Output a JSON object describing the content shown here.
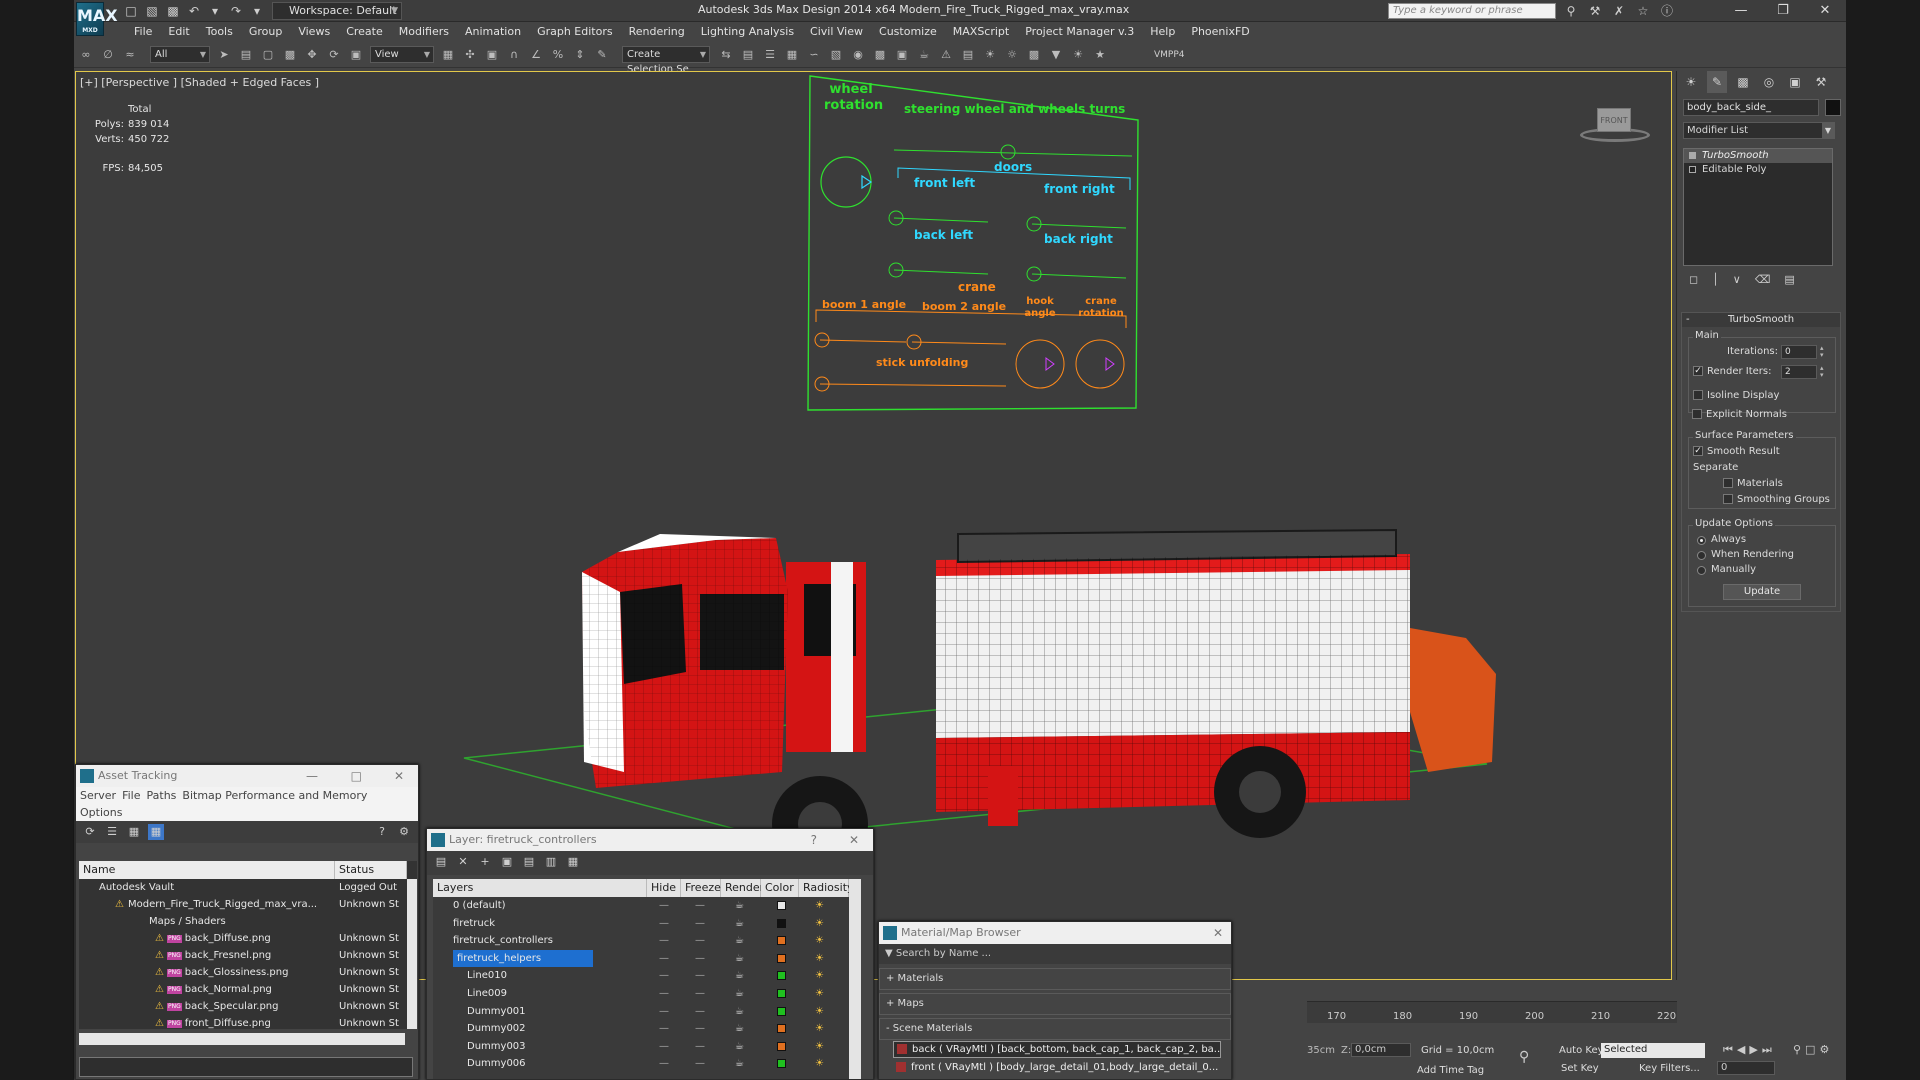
{
  "app": {
    "logo": "MAX",
    "title": "Autodesk 3ds Max Design 2014 x64     Modern_Fire_Truck_Rigged_max_vray.max",
    "workspace": "Workspace: Default",
    "search_placeholder": "Type a keyword or phrase"
  },
  "menu": [
    "File",
    "Edit",
    "Tools",
    "Group",
    "Views",
    "Create",
    "Modifiers",
    "Animation",
    "Graph Editors",
    "Rendering",
    "Lighting Analysis",
    "Civil View",
    "Customize",
    "MAXScript",
    "Project Manager v.3",
    "Help",
    "PhoenixFD"
  ],
  "toolbar": {
    "filter": "All",
    "refcoord": "View",
    "selection_set": "Create Selection Se",
    "vmpp": "VMPP4"
  },
  "viewport": {
    "label": "[+] [Perspective ] [Shaded + Edged Faces ]",
    "stats": {
      "total_label": "Total",
      "polys_label": "Polys:",
      "polys": "839 014",
      "verts_label": "Verts:",
      "verts": "450 722",
      "fps_label": "FPS:",
      "fps": "84,505"
    },
    "viewcube": "FRONT",
    "rig": {
      "wheel_rotation": "wheel\nrotation",
      "steering": "steering wheel and wheels turns",
      "doors": "doors",
      "front_left": "front left",
      "front_right": "front right",
      "back_left": "back left",
      "back_right": "back right",
      "crane": "crane",
      "boom1": "boom 1 angle",
      "boom2": "boom 2 angle",
      "hook": "hook angle",
      "crane_rotation": "crane rotation",
      "stick": "stick unfolding"
    }
  },
  "command_panel": {
    "object_name": "body_back_side_",
    "modifier_list": "Modifier List",
    "stack": [
      "TurboSmooth",
      "Editable Poly"
    ],
    "rollout_title": "TurboSmooth",
    "main": "Main",
    "iterations_label": "Iterations:",
    "iterations": "0",
    "render_iters_label": "Render Iters:",
    "render_iters": "2",
    "isoline": "Isoline Display",
    "explicit_normals": "Explicit Normals",
    "surface_params": "Surface Parameters",
    "smooth_result": "Smooth Result",
    "separate": "Separate",
    "materials": "Materials",
    "smoothing_groups": "Smoothing Groups",
    "update_options": "Update Options",
    "always": "Always",
    "when_rendering": "When Rendering",
    "manually": "Manually",
    "update_button": "Update"
  },
  "asset_tracking": {
    "title": "Asset Tracking",
    "menu": [
      "Server",
      "File",
      "Paths",
      "Bitmap Performance and Memory",
      "Options"
    ],
    "columns": [
      "Name",
      "Status"
    ],
    "rows": [
      {
        "name": "Autodesk Vault",
        "status": "Logged Out"
      },
      {
        "name": "Modern_Fire_Truck_Rigged_max_vra...",
        "status": "Unknown St"
      },
      {
        "name": "Maps / Shaders",
        "status": ""
      },
      {
        "name": "back_Diffuse.png",
        "status": "Unknown St"
      },
      {
        "name": "back_Fresnel.png",
        "status": "Unknown St"
      },
      {
        "name": "back_Glossiness.png",
        "status": "Unknown St"
      },
      {
        "name": "back_Normal.png",
        "status": "Unknown St"
      },
      {
        "name": "back_Specular.png",
        "status": "Unknown St"
      },
      {
        "name": "front_Diffuse.png",
        "status": "Unknown St"
      }
    ]
  },
  "layer_dialog": {
    "title": "Layer: firetruck_controllers",
    "help": "?",
    "columns": [
      "Layers",
      "Hide",
      "Freeze",
      "Render",
      "Color",
      "Radiosity"
    ],
    "rows": [
      {
        "name": "0 (default)",
        "color": "#e8e8e8"
      },
      {
        "name": "firetruck",
        "color": "#111111"
      },
      {
        "name": "firetruck_controllers",
        "color": "#e07020"
      },
      {
        "name": "firetruck_helpers",
        "color": "#e07020"
      },
      {
        "name": "Line010",
        "color": "#20c020"
      },
      {
        "name": "Line009",
        "color": "#20c020"
      },
      {
        "name": "Dummy001",
        "color": "#20c020"
      },
      {
        "name": "Dummy002",
        "color": "#e07020"
      },
      {
        "name": "Dummy003",
        "color": "#e07020"
      },
      {
        "name": "Dummy006",
        "color": "#20c020"
      }
    ]
  },
  "material_browser": {
    "title": "Material/Map Browser",
    "search": "Search by Name ...",
    "sections": [
      "+ Materials",
      "+ Maps",
      "- Scene Materials"
    ],
    "items": [
      "back ( VRayMtl ) [back_bottom, back_cap_1, back_cap_2, ba...",
      "front ( VRayMtl ) [body_large_detail_01,body_large_detail_0..."
    ]
  },
  "timeline": {
    "ticks": [
      "170",
      "180",
      "190",
      "200",
      "210",
      "220"
    ]
  },
  "status": {
    "z_label": "Z:",
    "z": "0,0cm",
    "x_partial": "35cm",
    "grid": "Grid = 10,0cm",
    "add_time_tag": "Add Time Tag",
    "auto_key": "Auto Key",
    "selected": "Selected",
    "set_key": "Set Key",
    "key_filters": "Key Filters...",
    "frame": "0"
  }
}
